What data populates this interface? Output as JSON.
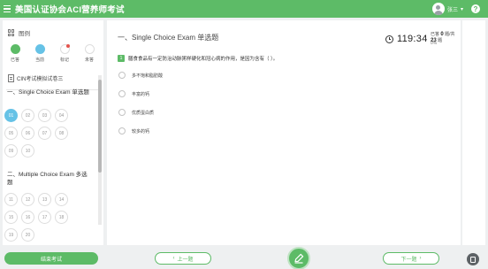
{
  "header": {
    "title": "美国认证协会ACI营养师考试",
    "user_name": "张三",
    "help": "?"
  },
  "sidebar": {
    "legend_title": "图例",
    "legend": [
      {
        "key": "answered",
        "label": "已答"
      },
      {
        "key": "current",
        "label": "当前"
      },
      {
        "key": "marked",
        "label": "标记"
      },
      {
        "key": "unanswered",
        "label": "未答"
      }
    ],
    "exam_name": "CIN考试模拟试卷三",
    "sections": [
      {
        "title": "一、Single Choice Exam 单选题",
        "questions": [
          "01",
          "02",
          "03",
          "04",
          "05",
          "06",
          "07",
          "08",
          "09",
          "10"
        ]
      },
      {
        "title": "二、Multiple Choice Exam 多选题",
        "questions": [
          "11",
          "12",
          "13",
          "14",
          "15",
          "16",
          "17",
          "18",
          "19",
          "20"
        ]
      }
    ],
    "current_question": "01",
    "finish_label": "结束考试"
  },
  "main": {
    "section_title": "一、Single Choice Exam 单选题",
    "timer": "119:34",
    "progress": {
      "prefix": "已答",
      "answered": "0",
      "sep": "题/共",
      "total": "23",
      "suffix": "题",
      "percent": "0%"
    },
    "question": {
      "number": "1",
      "text": "膳食食品有一定防治动脉粥样硬化和冠心病的作用，是因为含有（ ）。",
      "options": [
        "多不饱和脂肪酸",
        "丰富的钙",
        "优质蛋白质",
        "较多的钙"
      ]
    }
  },
  "footer": {
    "prev_label": "上一题",
    "next_label": "下一题"
  },
  "colors": {
    "brand": "#5dbb67",
    "current": "#66c2e6",
    "marked": "#e3534c"
  }
}
